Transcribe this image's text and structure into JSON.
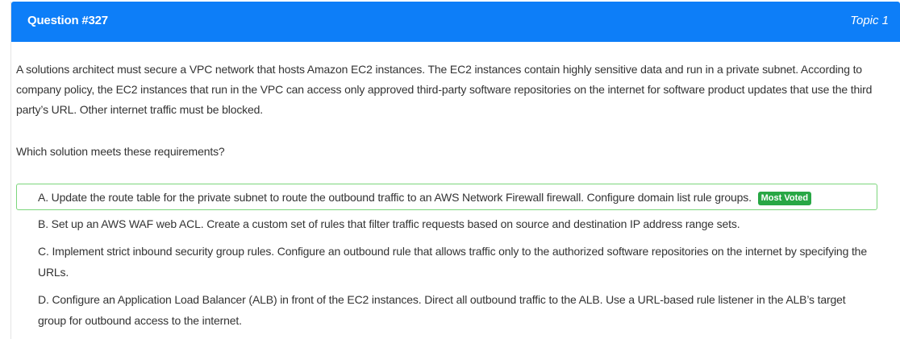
{
  "header": {
    "question_label": "Question #327",
    "topic_label": "Topic 1",
    "bg_color": "#0d7ef8"
  },
  "question": {
    "text": "A solutions architect must secure a VPC network that hosts Amazon EC2 instances. The EC2 instances contain highly sensitive data and run in a private subnet. According to company policy, the EC2 instances that run in the VPC can access only approved third-party software repositories on the internet for software product updates that use the third party’s URL. Other internet traffic must be blocked.",
    "prompt": "Which solution meets these requirements?"
  },
  "choices": [
    {
      "text": "A. Update the route table for the private subnet to route the outbound traffic to an AWS Network Firewall firewall. Configure domain list rule groups.",
      "badge": "Most Voted",
      "highlighted": true
    },
    {
      "text": "B. Set up an AWS WAF web ACL. Create a custom set of rules that filter traffic requests based on source and destination IP address range sets."
    },
    {
      "text": "C. Implement strict inbound security group rules. Configure an outbound rule that allows traffic only to the authorized software repositories on the internet by specifying the URLs."
    },
    {
      "text": "D. Configure an Application Load Balancer (ALB) in front of the EC2 instances. Direct all outbound traffic to the ALB. Use a URL-based rule listener in the ALB’s target group for outbound access to the internet."
    }
  ],
  "colors": {
    "badge": "#28a745",
    "highlight_border": "#7cd67c"
  }
}
